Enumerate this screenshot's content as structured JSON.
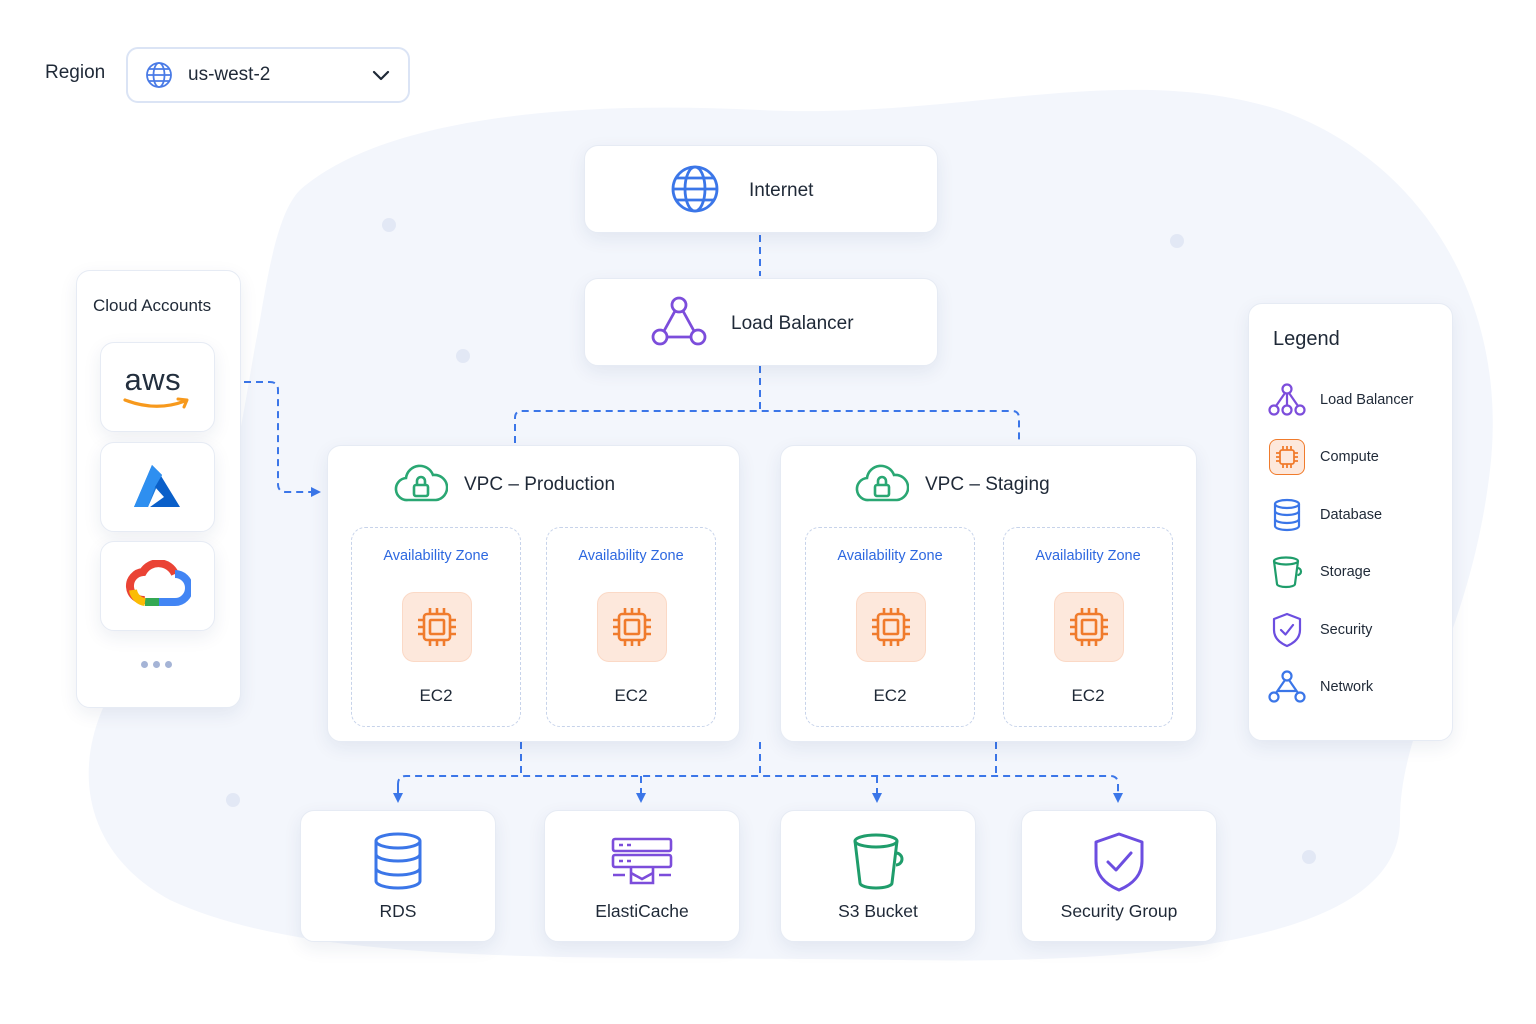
{
  "region": {
    "label": "Region",
    "value": "us-west-2",
    "icon": "globe-icon"
  },
  "top_nodes": {
    "internet": {
      "label": "Internet",
      "icon": "globe-icon"
    },
    "load_balancer": {
      "label": "Load Balancer",
      "icon": "load-balancer-icon"
    }
  },
  "accounts": {
    "title": "Cloud Accounts",
    "items": [
      {
        "icon": "aws-logo",
        "logo_text": "aws"
      },
      {
        "icon": "azure-logo"
      },
      {
        "icon": "google-cloud-logo"
      }
    ]
  },
  "vpcs": [
    {
      "title": "VPC – Production",
      "zones": [
        {
          "label": "Availability Zone",
          "instance": "EC2"
        },
        {
          "label": "Availability Zone",
          "instance": "EC2"
        }
      ]
    },
    {
      "title": "VPC – Staging",
      "zones": [
        {
          "label": "Availability Zone",
          "instance": "EC2"
        },
        {
          "label": "Availability Zone",
          "instance": "EC2"
        }
      ]
    }
  ],
  "services": [
    {
      "label": "RDS",
      "icon": "database-icon"
    },
    {
      "label": "ElastiCache",
      "icon": "cache-icon"
    },
    {
      "label": "S3 Bucket",
      "icon": "bucket-icon"
    },
    {
      "label": "Security Group",
      "icon": "shield-icon"
    }
  ],
  "legend": {
    "title": "Legend",
    "items": [
      {
        "label": "Load Balancer",
        "icon": "load-balancer-icon"
      },
      {
        "label": "Compute",
        "icon": "chip-icon"
      },
      {
        "label": "Database",
        "icon": "database-icon"
      },
      {
        "label": "Storage",
        "icon": "bucket-icon"
      },
      {
        "label": "Security",
        "icon": "shield-icon"
      },
      {
        "label": "Network",
        "icon": "network-icon"
      }
    ]
  },
  "colors": {
    "accent": "#2d68e0",
    "connector": "#3b76e8",
    "compute": "#f07b2c",
    "compute_bg": "#fde8dc",
    "lb": "#7c4ddb",
    "storage": "#1f9d6b",
    "security": "#6c4ee0",
    "vpc": "#2aa773"
  }
}
